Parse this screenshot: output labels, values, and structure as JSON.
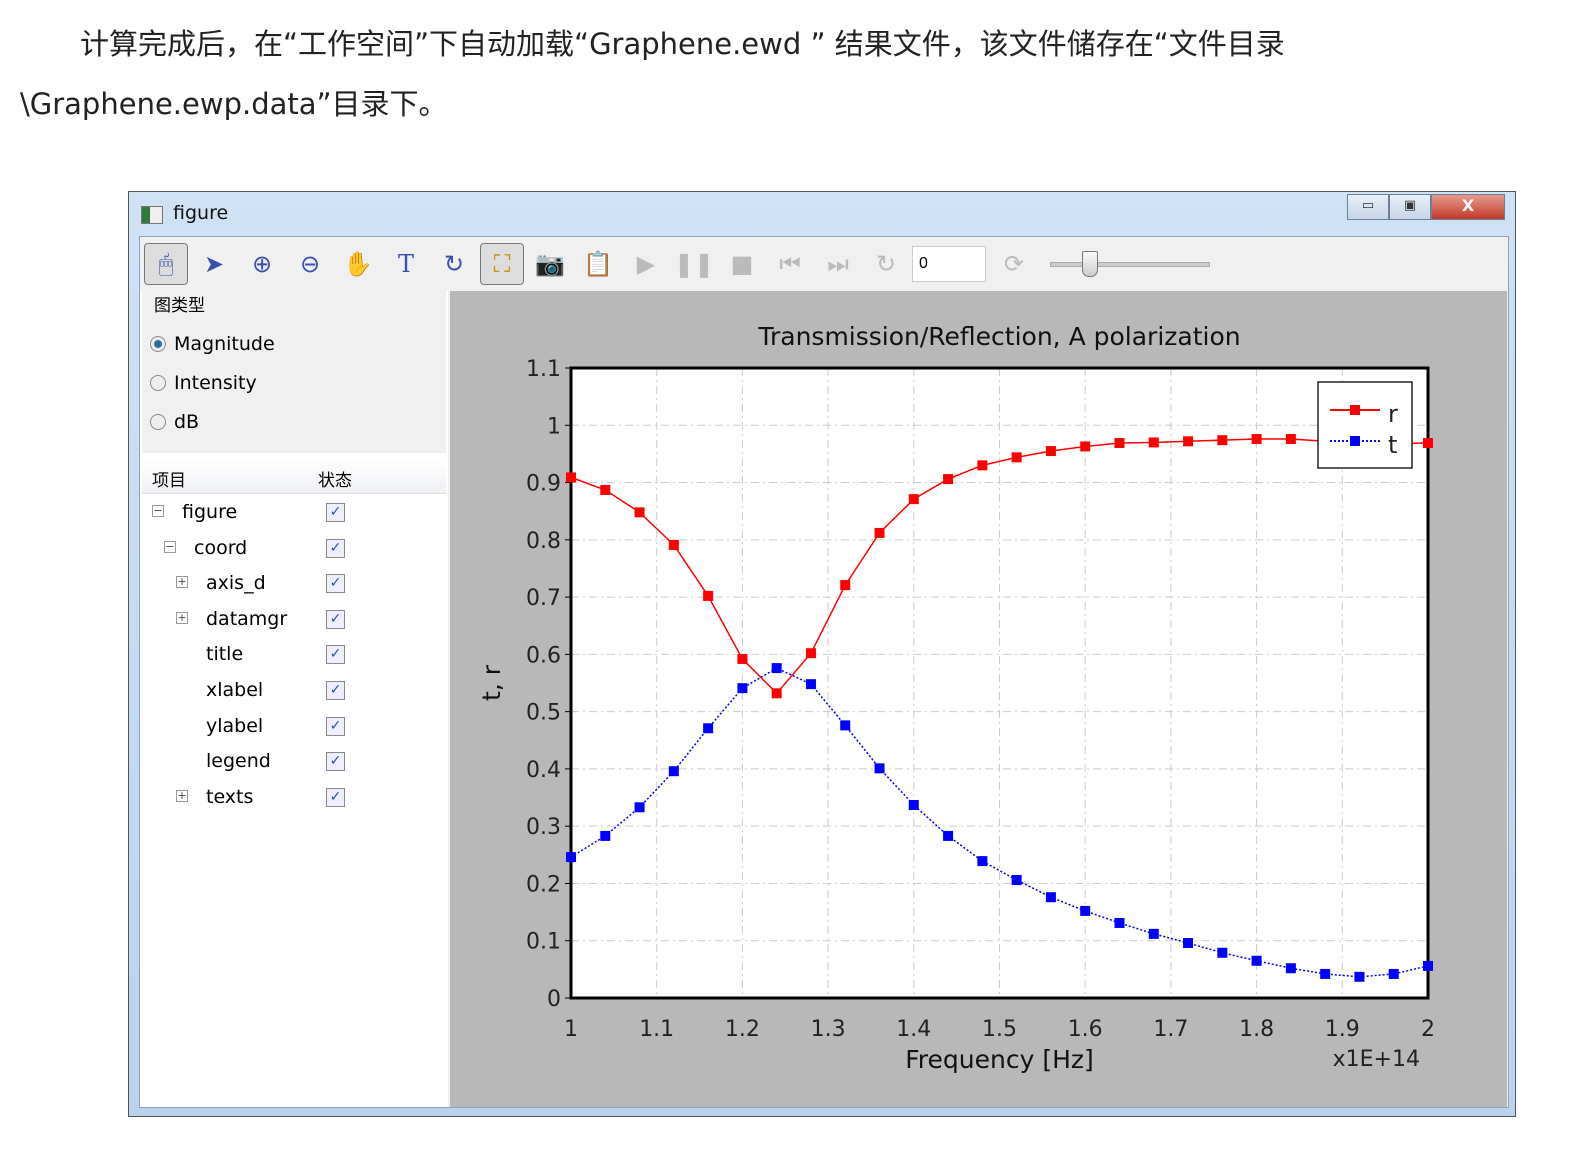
{
  "paragraph": {
    "line1": "计算完成后，在“工作空间”下自动加载“Graphene.ewd ” 结果文件，该文件储存在“文件目录",
    "line2": "\\Graphene.ewp.data”目录下。"
  },
  "window": {
    "title": "figure",
    "min": "▭",
    "max": "▣",
    "close": "X"
  },
  "toolbar": {
    "frame_value": "0",
    "slider_value": 0.25,
    "icons": [
      "mouse-mode-icon",
      "pointer-icon",
      "zoom-in-icon",
      "zoom-out-icon",
      "pan-hand-icon",
      "text-icon",
      "rotate-icon",
      "layout-tree-icon",
      "camera-icon",
      "clipboard-camera-icon",
      "play-icon",
      "pause-icon",
      "stop-icon",
      "skip-back-icon",
      "skip-forward-icon",
      "refresh-icon"
    ]
  },
  "plot_type": {
    "title": "图类型",
    "options": [
      {
        "label": "Magnitude",
        "selected": true
      },
      {
        "label": "Intensity",
        "selected": false
      },
      {
        "label": "dB",
        "selected": false
      }
    ]
  },
  "tree": {
    "headers": [
      "项目",
      "状态"
    ],
    "rows": [
      {
        "label": "figure",
        "level": 0,
        "expander": "−",
        "checked": true
      },
      {
        "label": "coord",
        "level": 1,
        "expander": "−",
        "checked": true
      },
      {
        "label": "axis_d",
        "level": 2,
        "expander": "+",
        "checked": true
      },
      {
        "label": "datamgr",
        "level": 2,
        "expander": "+",
        "checked": true
      },
      {
        "label": "title",
        "level": 2,
        "expander": "",
        "checked": true
      },
      {
        "label": "xlabel",
        "level": 2,
        "expander": "",
        "checked": true
      },
      {
        "label": "ylabel",
        "level": 2,
        "expander": "",
        "checked": true
      },
      {
        "label": "legend",
        "level": 2,
        "expander": "",
        "checked": true
      },
      {
        "label": "texts",
        "level": 2,
        "expander": "+",
        "checked": true
      }
    ]
  },
  "chart_data": {
    "type": "line",
    "title": "Transmission/Reflection, A polarization",
    "xlabel": "Frequency [Hz]",
    "ylabel": "t, r",
    "x_multiplier": "x1E+14",
    "xlim": [
      1,
      2
    ],
    "ylim": [
      0,
      1.1
    ],
    "xticks": [
      "1",
      "1.1",
      "1.2",
      "1.3",
      "1.4",
      "1.5",
      "1.6",
      "1.7",
      "1.8",
      "1.9",
      "2"
    ],
    "yticks": [
      "0",
      "0.1",
      "0.2",
      "0.3",
      "0.4",
      "0.5",
      "0.6",
      "0.7",
      "0.8",
      "0.9",
      "1",
      "1.1"
    ],
    "grid": true,
    "legend_position": "top-right",
    "x": [
      1,
      1.04,
      1.08,
      1.12,
      1.16,
      1.2,
      1.24,
      1.28,
      1.32,
      1.36,
      1.4,
      1.44,
      1.48,
      1.52,
      1.56,
      1.6,
      1.64,
      1.68,
      1.72,
      1.76,
      1.8,
      1.84,
      1.88,
      1.92,
      1.96,
      2
    ],
    "series": [
      {
        "name": "r",
        "color": "#ff0000",
        "style": "solid",
        "values": [
          0.909,
          0.887,
          0.848,
          0.791,
          0.702,
          0.592,
          0.532,
          0.602,
          0.721,
          0.812,
          0.871,
          0.906,
          0.93,
          0.944,
          0.955,
          0.963,
          0.969,
          0.97,
          0.972,
          0.974,
          0.976,
          0.976,
          0.972,
          0.97,
          0.968,
          0.969
        ]
      },
      {
        "name": "t",
        "color": "#0000ff",
        "style": "dotted",
        "values": [
          0.246,
          0.283,
          0.333,
          0.396,
          0.471,
          0.541,
          0.576,
          0.548,
          0.476,
          0.401,
          0.337,
          0.283,
          0.239,
          0.206,
          0.176,
          0.152,
          0.131,
          0.112,
          0.096,
          0.079,
          0.065,
          0.052,
          0.042,
          0.037,
          0.042,
          0.056
        ]
      }
    ]
  }
}
